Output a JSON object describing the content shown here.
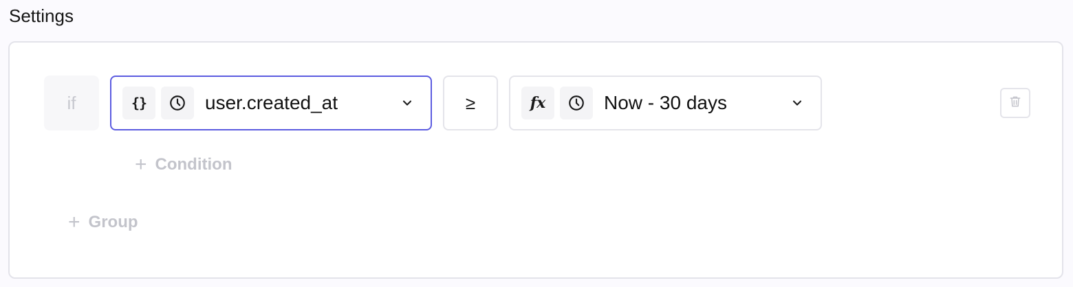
{
  "page": {
    "title": "Settings"
  },
  "rule": {
    "if_label": "if",
    "left_operand": {
      "type_icon": "braces-icon",
      "kind_icon": "clock-icon",
      "value": "user.created_at"
    },
    "operator": "≥",
    "right_operand": {
      "type_icon": "function-fx-icon",
      "type_glyph": "fx",
      "kind_icon": "clock-icon",
      "value": "Now - 30 days"
    },
    "delete_icon": "trash-icon"
  },
  "actions": {
    "add_condition_label": "Condition",
    "add_group_label": "Group"
  },
  "colors": {
    "focus_border": "#5b5be0",
    "muted_text": "#c3c4cb",
    "border": "#e4e4ea"
  }
}
